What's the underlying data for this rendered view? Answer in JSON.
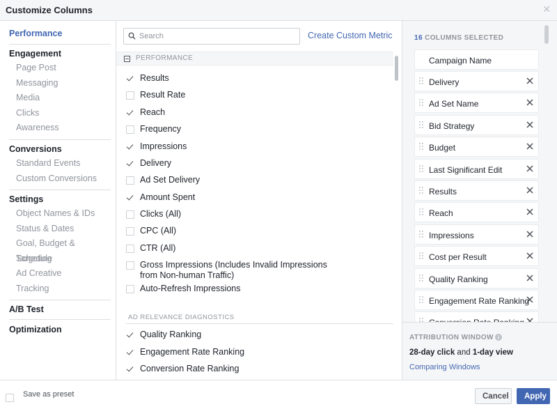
{
  "dialog": {
    "title": "Customize Columns"
  },
  "nav": {
    "performance": "Performance",
    "engagement": "Engagement",
    "engagement_items": [
      "Page Post",
      "Messaging",
      "Media",
      "Clicks",
      "Awareness"
    ],
    "conversions": "Conversions",
    "conversions_items": [
      "Standard Events",
      "Custom Conversions"
    ],
    "settings": "Settings",
    "settings_items": [
      "Object Names & IDs",
      "Status & Dates",
      "Goal, Budget & Schedule",
      "Targeting",
      "Ad Creative",
      "Tracking"
    ],
    "ab_test": "A/B Test",
    "optimization": "Optimization"
  },
  "search": {
    "placeholder": "Search"
  },
  "create_metric": "Create Custom Metric",
  "performance_section": {
    "label": "PERFORMANCE",
    "items": [
      {
        "label": "Results",
        "checked": true
      },
      {
        "label": "Result Rate",
        "checked": false
      },
      {
        "label": "Reach",
        "checked": true
      },
      {
        "label": "Frequency",
        "checked": false
      },
      {
        "label": "Impressions",
        "checked": true
      },
      {
        "label": "Delivery",
        "checked": true
      },
      {
        "label": "Ad Set Delivery",
        "checked": false
      },
      {
        "label": "Amount Spent",
        "checked": true
      },
      {
        "label": "Clicks (All)",
        "checked": false
      },
      {
        "label": "CPC (All)",
        "checked": false
      },
      {
        "label": "CTR (All)",
        "checked": false
      },
      {
        "label": "Gross Impressions (Includes Invalid Impressions from Non-human Traffic)",
        "checked": false
      },
      {
        "label": "Auto-Refresh Impressions",
        "checked": false
      }
    ]
  },
  "ad_relevance": {
    "label": "AD RELEVANCE DIAGNOSTICS",
    "items": [
      {
        "label": "Quality Ranking",
        "checked": true
      },
      {
        "label": "Engagement Rate Ranking",
        "checked": true
      },
      {
        "label": "Conversion Rate Ranking",
        "checked": true
      }
    ]
  },
  "selected": {
    "count": "16",
    "count_label": "COLUMNS SELECTED",
    "fixed": "Campaign Name",
    "items": [
      "Delivery",
      "Ad Set Name",
      "Bid Strategy",
      "Budget",
      "Last Significant Edit",
      "Results",
      "Reach",
      "Impressions",
      "Cost per Result",
      "Quality Ranking",
      "Engagement Rate Ranking",
      "Conversion Rate Ranking"
    ]
  },
  "attribution": {
    "title": "ATTRIBUTION WINDOW",
    "click": "28-day click",
    "and": "and",
    "view": "1-day view",
    "link": "Comparing Windows"
  },
  "footer": {
    "preset_label": "Save as preset",
    "cancel": "Cancel",
    "apply": "Apply"
  },
  "colors": {
    "accent": "#4267b2",
    "muted": "#90949c",
    "panel": "#f5f6f7"
  }
}
